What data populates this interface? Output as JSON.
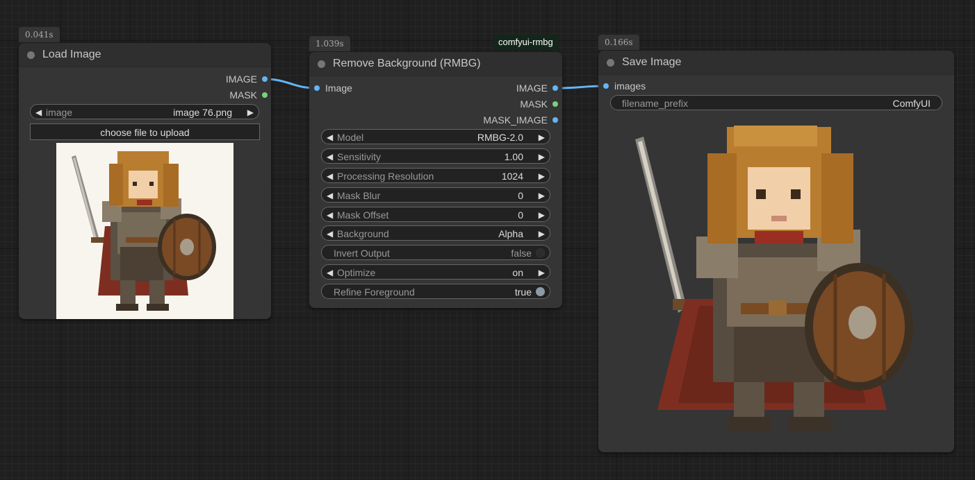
{
  "nodes": {
    "load_image": {
      "timing": "0.041s",
      "title": "Load Image",
      "outputs": [
        "IMAGE",
        "MASK"
      ],
      "image_widget": {
        "label": "image",
        "value": "image 76.png"
      },
      "upload_label": "choose file to upload"
    },
    "remove_bg": {
      "timing": "1.039s",
      "badge": "comfyui-rmbg",
      "title": "Remove Background (RMBG)",
      "input": "Image",
      "outputs": [
        "IMAGE",
        "MASK",
        "MASK_IMAGE"
      ],
      "widgets": [
        {
          "label": "Model",
          "value": "RMBG-2.0"
        },
        {
          "label": "Sensitivity",
          "value": "1.00"
        },
        {
          "label": "Processing Resolution",
          "value": "1024"
        },
        {
          "label": "Mask Blur",
          "value": "0"
        },
        {
          "label": "Mask Offset",
          "value": "0"
        },
        {
          "label": "Background",
          "value": "Alpha"
        },
        {
          "label": "Invert Output",
          "value": "false"
        },
        {
          "label": "Optimize",
          "value": "on"
        },
        {
          "label": "Refine Foreground",
          "value": "true"
        }
      ]
    },
    "save_image": {
      "timing": "0.166s",
      "title": "Save Image",
      "input": "images",
      "filename_prefix": {
        "label": "filename_prefix",
        "value": "ComfyUI"
      }
    }
  },
  "colors": {
    "link_image": "#64b5f6",
    "slot_mask": "#7bd07b",
    "canvas_bg": "#1f1f1f",
    "node_bg": "#353535"
  }
}
